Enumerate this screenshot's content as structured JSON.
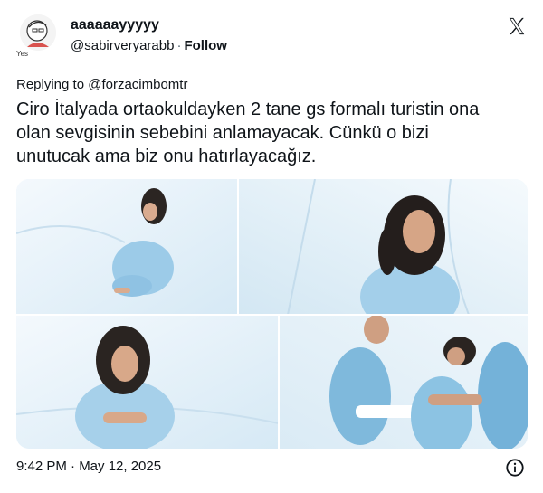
{
  "author": {
    "display_name": "aaaaaayyyyy",
    "handle": "@sabirveryarabb",
    "separator": "·",
    "follow_label": "Follow",
    "avatar_caption": "Yes"
  },
  "reply": {
    "text": "Replying to @forzacimbomtr"
  },
  "tweet": {
    "lines": [
      "Ciro İtalyada ortaokuldayken 2 tane gs formalı turistin ona",
      "olan sevgisinin sebebini anlamayacak. Cünkü o bizi",
      "unutucak ama biz onu hatırlayacağız."
    ]
  },
  "media": {
    "panels": [
      "crouching-patient",
      "patient-against-wall",
      "sitting-patient",
      "orderlies-restraining-patient"
    ]
  },
  "footer": {
    "timestamp": "9:42 PM · May 12, 2025"
  },
  "icons": {
    "logo": "x-logo-icon",
    "info": "info-icon"
  },
  "colors": {
    "text": "#0f1419",
    "secondary": "#536471",
    "room": "#eaf4fb",
    "gown": "#8ec6e6"
  }
}
